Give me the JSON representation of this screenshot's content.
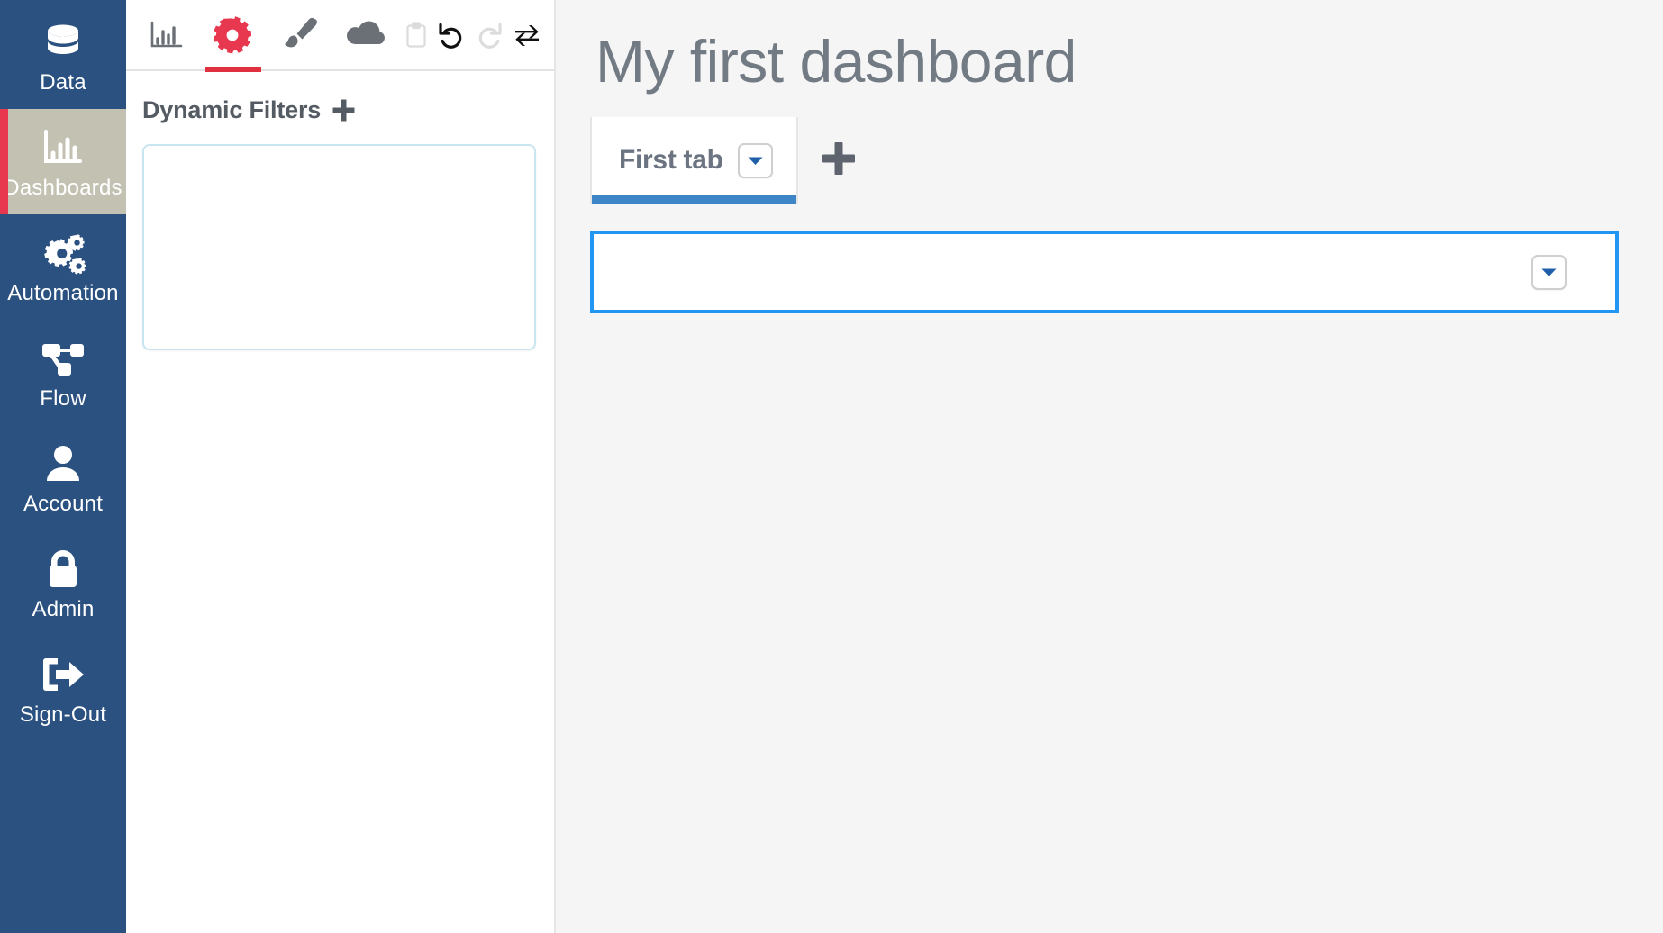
{
  "sidebar": {
    "items": [
      {
        "id": "data",
        "label": "Data",
        "icon": "database-icon",
        "active": false
      },
      {
        "id": "dashboards",
        "label": "Dashboards",
        "icon": "bar-chart-icon",
        "active": true
      },
      {
        "id": "automation",
        "label": "Automation",
        "icon": "gears-icon",
        "active": false
      },
      {
        "id": "flow",
        "label": "Flow",
        "icon": "flow-nodes-icon",
        "active": false
      },
      {
        "id": "account",
        "label": "Account",
        "icon": "user-icon",
        "active": false
      },
      {
        "id": "admin",
        "label": "Admin",
        "icon": "lock-icon",
        "active": false
      },
      {
        "id": "signout",
        "label": "Sign-Out",
        "icon": "sign-out-icon",
        "active": false
      }
    ],
    "colors": {
      "background": "#2b5180",
      "active_background": "#c3c2b2",
      "active_marker": "#e8384f"
    }
  },
  "editor": {
    "toolbar": {
      "items": [
        {
          "id": "charts",
          "icon": "bar-chart-icon",
          "state": "inactive"
        },
        {
          "id": "settings",
          "icon": "gear-icon",
          "state": "active"
        },
        {
          "id": "style",
          "icon": "paintbrush-icon",
          "state": "inactive"
        },
        {
          "id": "publish",
          "icon": "cloud-icon",
          "state": "inactive"
        },
        {
          "id": "clipboard",
          "icon": "clipboard-icon",
          "state": "disabled"
        },
        {
          "id": "undo",
          "icon": "undo-icon",
          "state": "enabled"
        },
        {
          "id": "redo",
          "icon": "redo-icon",
          "state": "disabled"
        },
        {
          "id": "swap",
          "icon": "swap-arrows-icon",
          "state": "enabled"
        }
      ],
      "active_color": "#e0303f"
    },
    "filters": {
      "title": "Dynamic Filters",
      "add_icon": "plus-icon",
      "dropzone_items": [],
      "dropzone_border_color": "#c9e6f0"
    }
  },
  "main": {
    "title": "My first dashboard",
    "tabs": [
      {
        "id": "tab-1",
        "label": "First tab",
        "active": true,
        "menu_icon": "chevron-down-icon"
      }
    ],
    "add_tab_icon": "plus-icon",
    "active_tab_underline_color": "#3d85c6",
    "widgets": [
      {
        "id": "widget-1",
        "type": "select",
        "value": "",
        "placeholder": "",
        "selected": true,
        "selection_color": "#2196f3",
        "dropdown_icon": "chevron-down-icon"
      }
    ]
  }
}
